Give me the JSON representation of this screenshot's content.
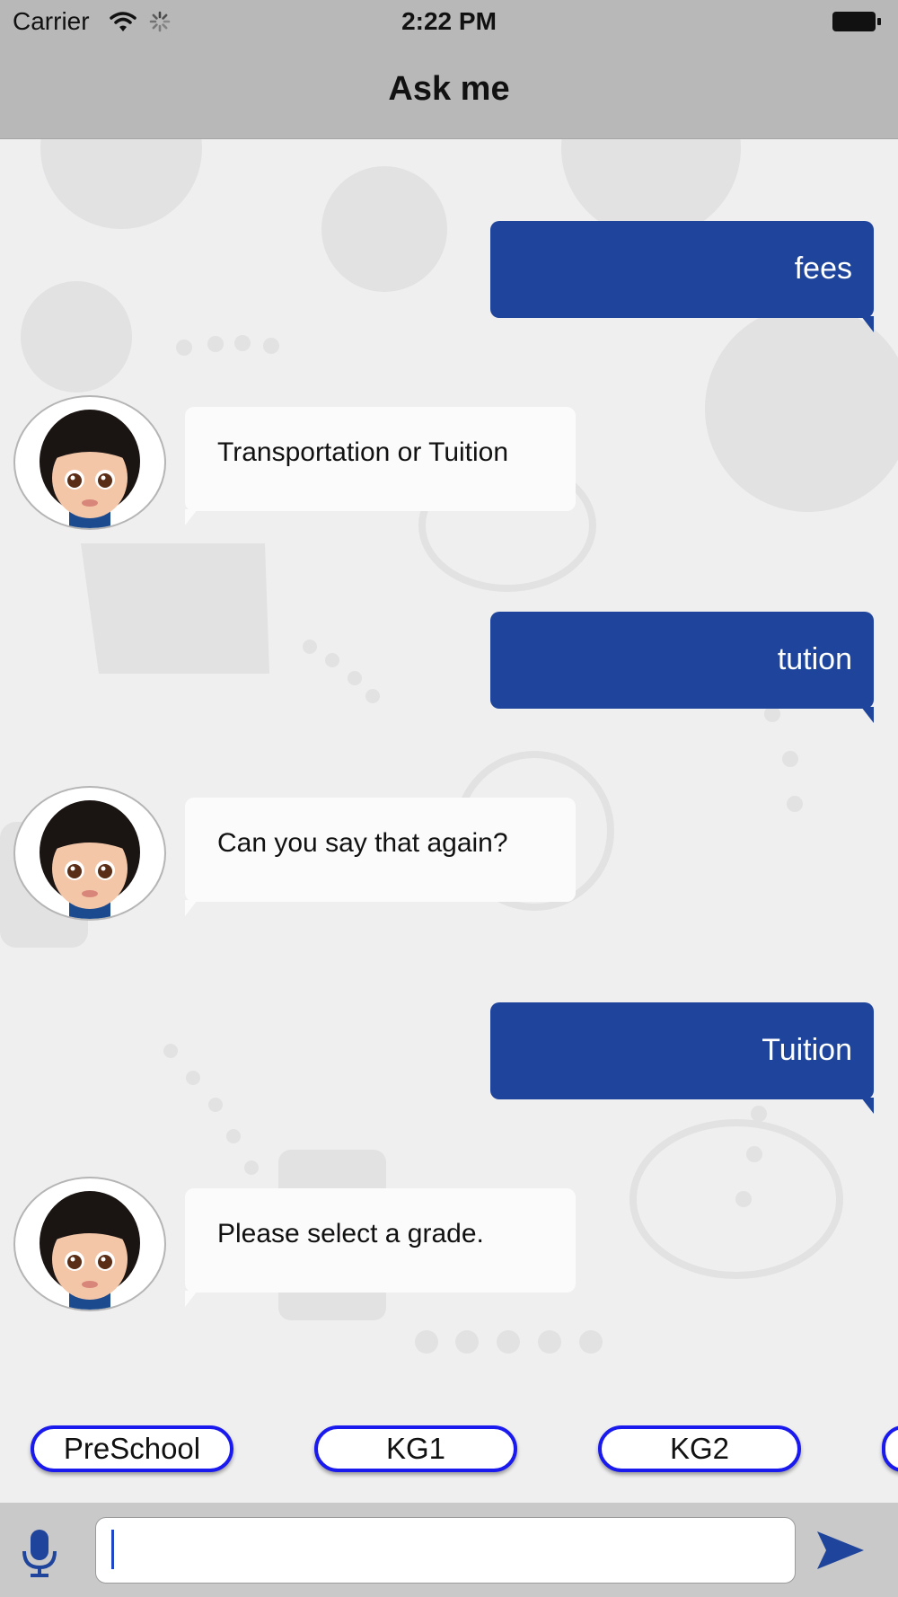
{
  "status_bar": {
    "carrier": "Carrier",
    "time": "2:22 PM"
  },
  "header": {
    "title": "Ask me"
  },
  "colors": {
    "accent": "#1f449b",
    "chip_border": "#1a1aee",
    "bot_bubble": "#fcfbfc",
    "background": "#efeff0",
    "bar": "#b8b8b8"
  },
  "messages": [
    {
      "sender": "user",
      "text": "fees"
    },
    {
      "sender": "bot",
      "text": "Transportation or Tuition"
    },
    {
      "sender": "user",
      "text": "tution"
    },
    {
      "sender": "bot",
      "text": "Can you say that again?"
    },
    {
      "sender": "user",
      "text": "Tuition"
    },
    {
      "sender": "bot",
      "text": "Please select a grade."
    }
  ],
  "quick_replies": [
    "PreSchool",
    "KG1",
    "KG2"
  ],
  "input": {
    "value": "",
    "mic_icon": "microphone-icon",
    "send_icon": "send-arrow-icon"
  }
}
